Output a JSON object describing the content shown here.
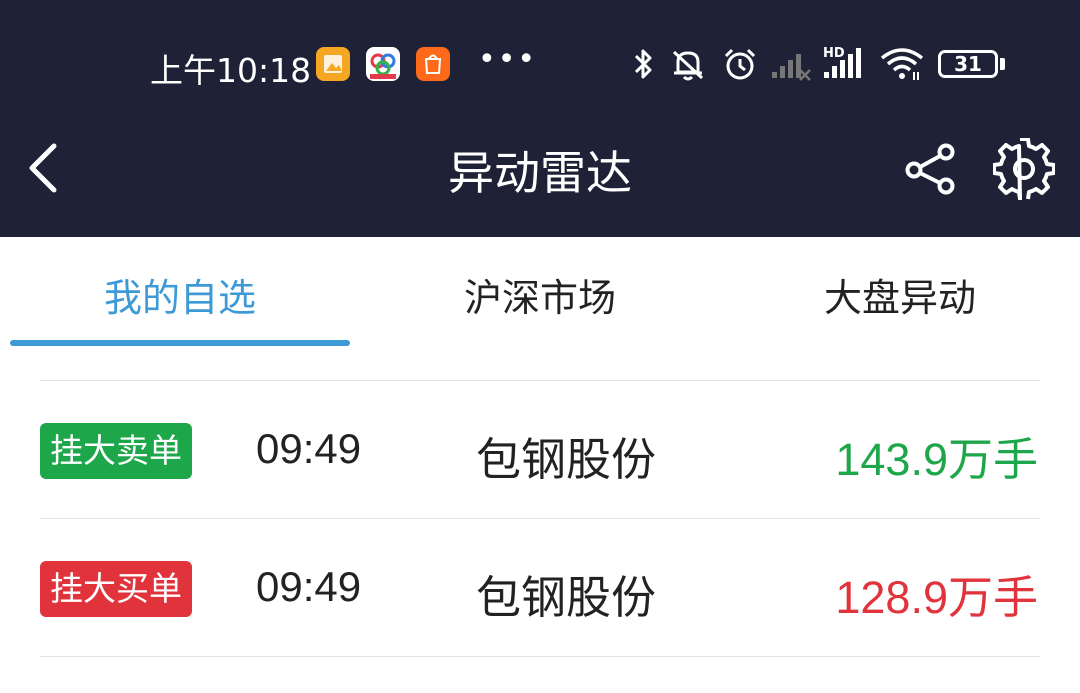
{
  "status_bar": {
    "time": "上午10:18",
    "more": "•••",
    "battery": "31",
    "notification_icons": [
      "gallery-icon",
      "cloud-app-icon",
      "mi-store-icon"
    ],
    "right_icons": [
      "bluetooth-icon",
      "mute-icon",
      "alarm-icon",
      "signal-1-icon",
      "signal-hd-icon",
      "wifi-icon",
      "battery-icon"
    ]
  },
  "nav": {
    "title": "异动雷达",
    "icons": [
      "back-icon",
      "share-icon",
      "settings-icon"
    ]
  },
  "tabs": [
    {
      "label": "我的自选",
      "active": true
    },
    {
      "label": "沪深市场",
      "active": false
    },
    {
      "label": "大盘异动",
      "active": false
    }
  ],
  "colors": {
    "header_bg": "#1f2236",
    "accent": "#3d9ad7",
    "sell_green": "#1ea64a",
    "buy_red": "#e0333c"
  },
  "rows": [
    {
      "tag": "挂大卖单",
      "time": "09:49",
      "stock": "包钢股份",
      "volume": "143.9万手",
      "type": "sell"
    },
    {
      "tag": "挂大买单",
      "time": "09:49",
      "stock": "包钢股份",
      "volume": "128.9万手",
      "type": "buy"
    }
  ]
}
